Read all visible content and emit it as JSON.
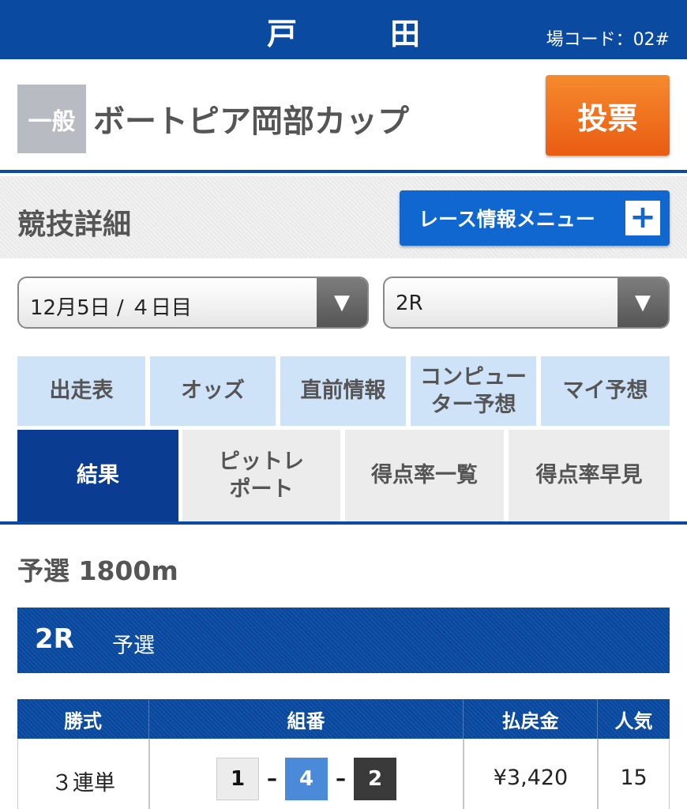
{
  "header": {
    "venue": "戸　田",
    "venue_code": "場コード：02#"
  },
  "race_head": {
    "grade": "一般",
    "title": "ボートピア岡部カップ",
    "vote_label": "投票"
  },
  "detail": {
    "title": "競技詳細",
    "menu_label": "レース情報メニュー",
    "menu_icon": "plus-icon"
  },
  "selects": {
    "date": {
      "value": "12月5日 / ４日目",
      "icon": "chevron-down-icon"
    },
    "race": {
      "value": "2R",
      "icon": "chevron-down-icon"
    }
  },
  "tabs_row1": [
    "出走表",
    "オッズ",
    "直前情報",
    "コンピュー\nター予想",
    "マイ予想"
  ],
  "tabs_row2": [
    "結果",
    "ピットレ\nポート",
    "得点率一覧",
    "得点率早見"
  ],
  "active_tab": "結果",
  "section": {
    "title": "予選 1800m"
  },
  "race_bar": {
    "number": "2R",
    "type": "予選"
  },
  "payout_table": {
    "headers": [
      "勝式",
      "組番",
      "払戻金",
      "人気"
    ],
    "rows": [
      {
        "bet_type": "３連単",
        "combo": [
          "1",
          "4",
          "2"
        ],
        "payout": "¥3,420",
        "popularity": "15"
      }
    ]
  },
  "colors": {
    "header": "#0a4aa0",
    "vote": "#ea5c12",
    "menu": "#1167d0",
    "active_tab": "#0a3d91"
  }
}
